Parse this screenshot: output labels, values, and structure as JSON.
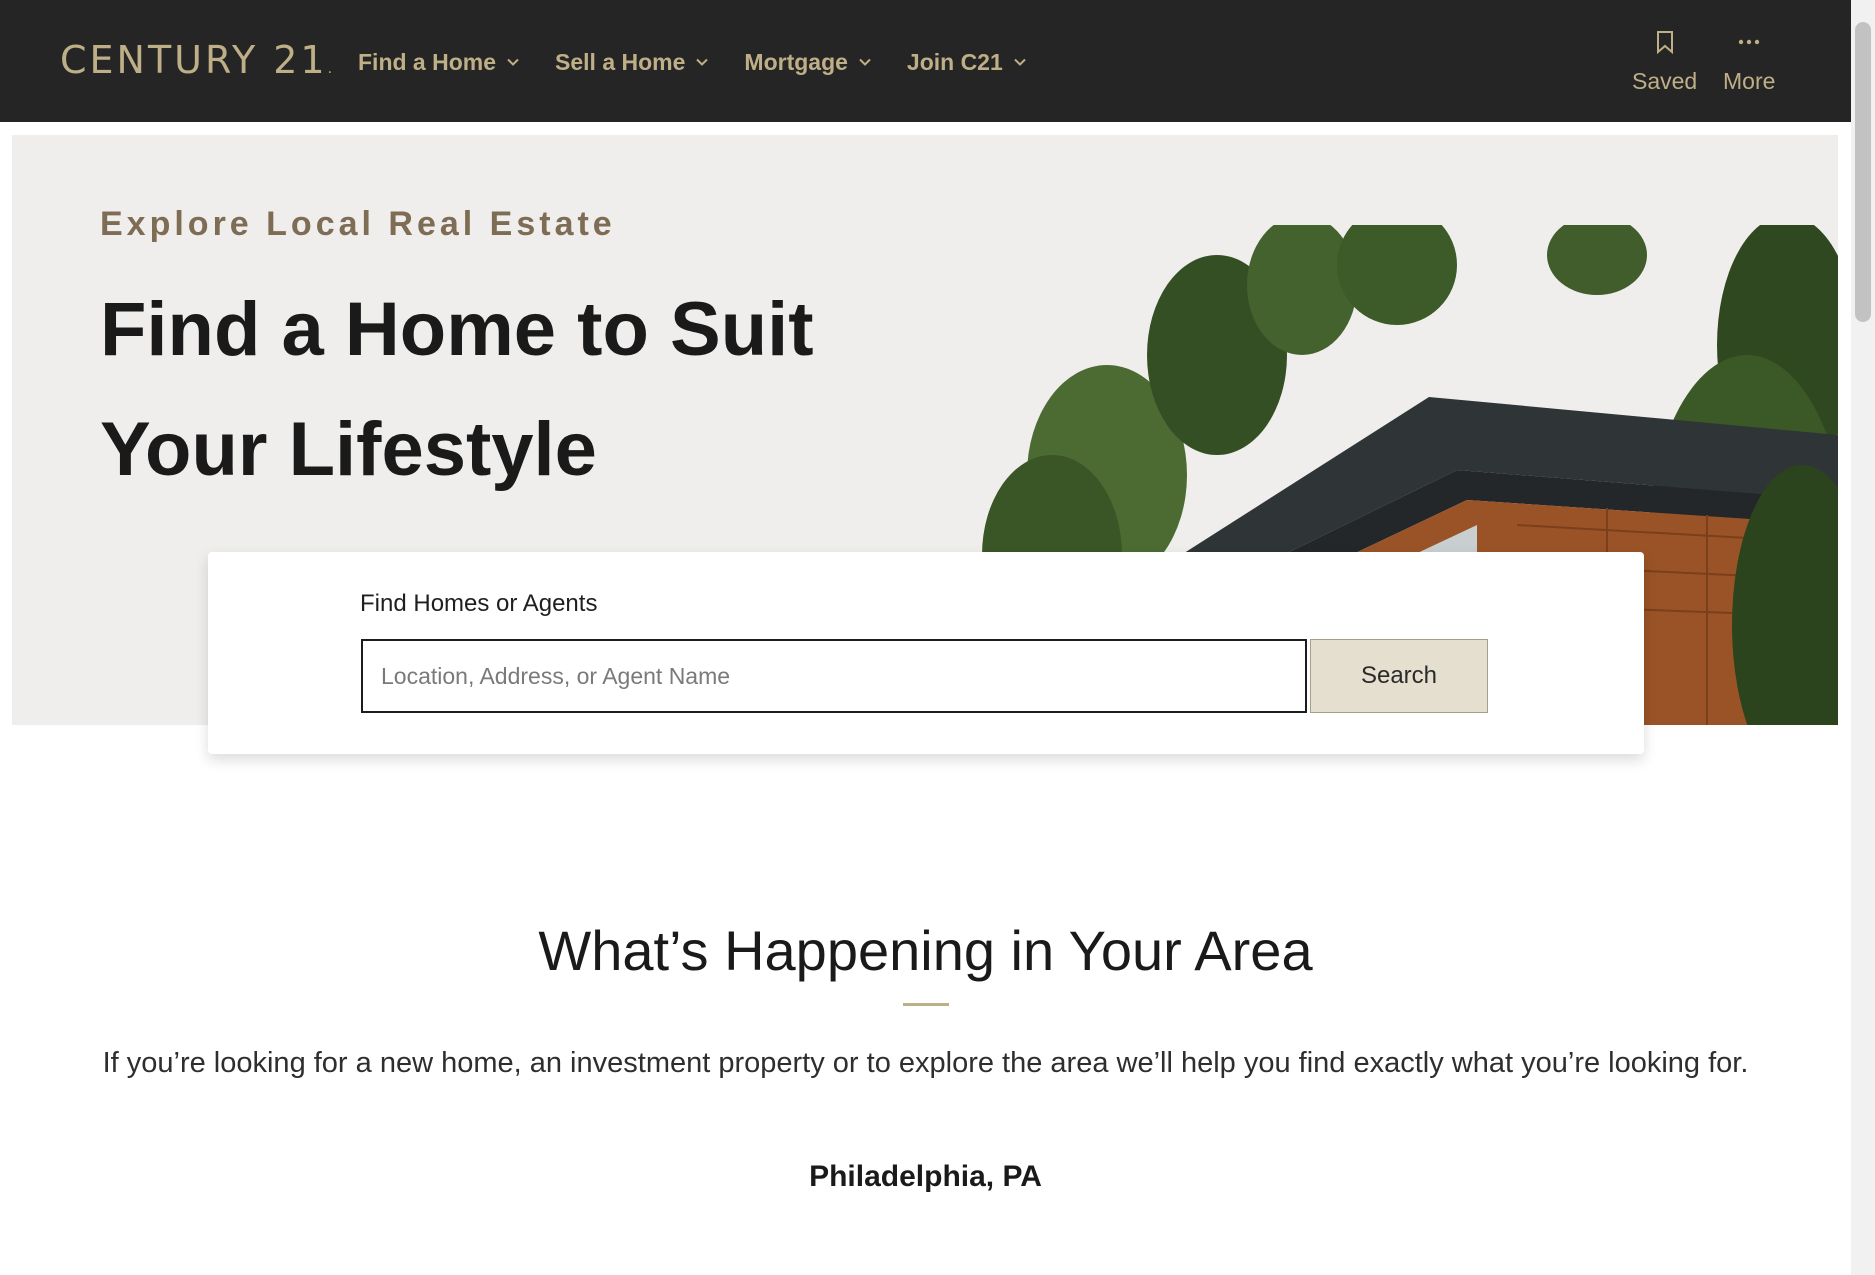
{
  "header": {
    "logo_text": "CENTURY 21",
    "logo_mark": ".",
    "nav": [
      {
        "label": "Find a Home",
        "icon": "chevron-down-icon"
      },
      {
        "label": "Sell a Home",
        "icon": "chevron-down-icon"
      },
      {
        "label": "Mortgage",
        "icon": "chevron-down-icon"
      },
      {
        "label": "Join C21",
        "icon": "chevron-down-icon"
      }
    ],
    "saved": {
      "label": "Saved",
      "icon": "bookmark-icon"
    },
    "more": {
      "label": "More",
      "icon": "ellipsis-icon"
    }
  },
  "hero": {
    "eyebrow": "Explore Local Real Estate",
    "title": "Find a Home to Suit Your Lifestyle",
    "image": "modern-house-with-trees"
  },
  "search": {
    "label": "Find Homes or Agents",
    "placeholder": "Location, Address, or Agent Name",
    "value": "",
    "button_label": "Search"
  },
  "section": {
    "title": "What’s Happening in Your Area",
    "description": "If you’re looking for a new home, an investment property or to explore the area we’ll help you find exactly what you’re looking for.",
    "location": "Philadelphia, PA"
  },
  "colors": {
    "header_bg": "#252526",
    "brand_gold": "#beaf87",
    "hero_bg": "#efeeec",
    "eyebrow": "#7e6d54",
    "search_button_bg": "#e5dfcf"
  }
}
